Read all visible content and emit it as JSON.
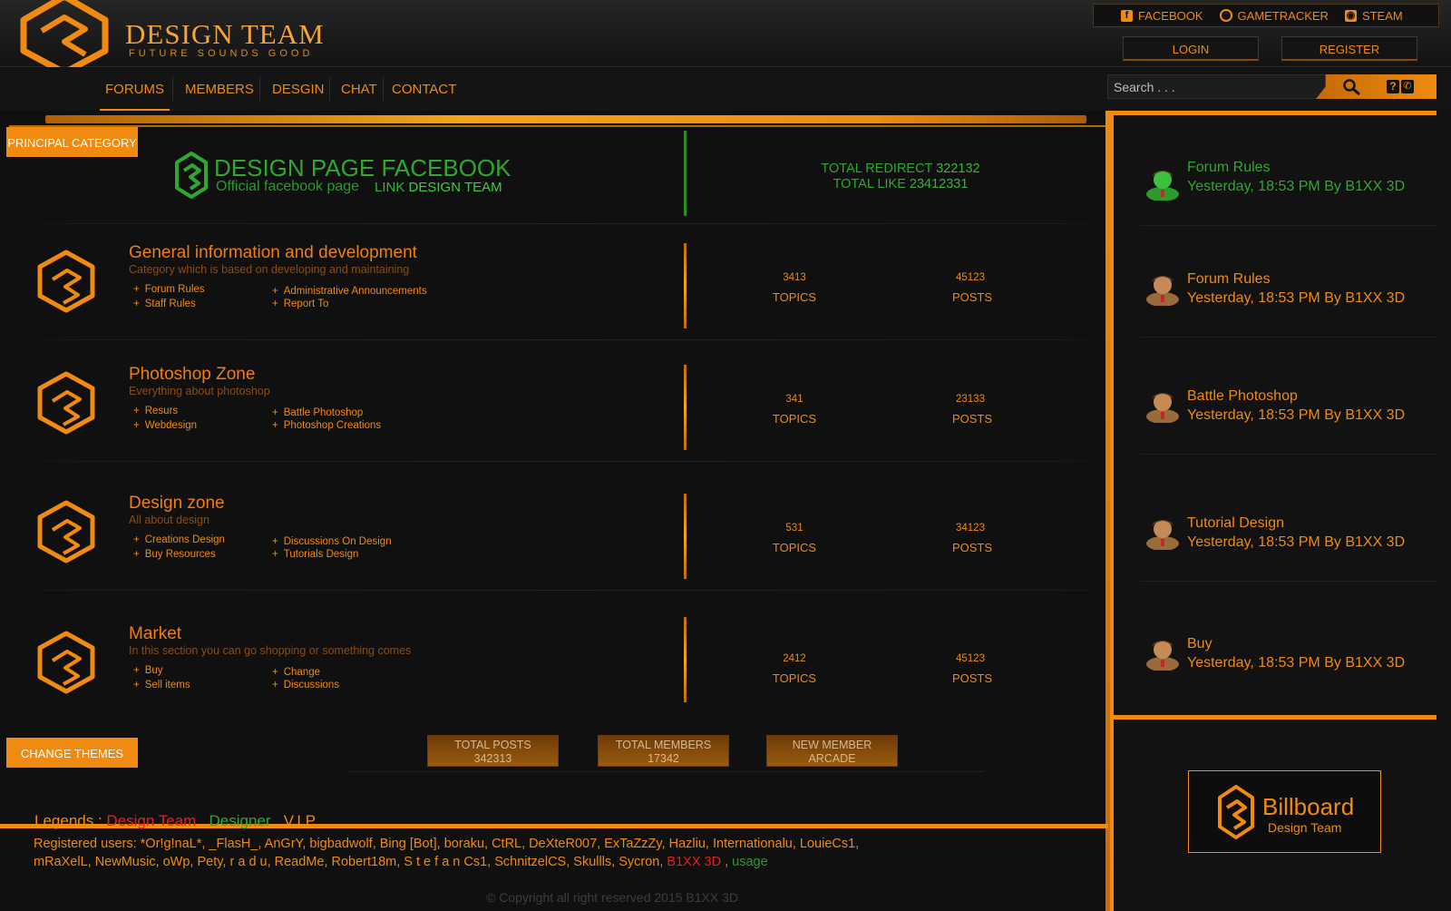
{
  "brand": {
    "title": "DESIGN TEAM",
    "tagline": "FUTURE SOUNDS GOOD"
  },
  "social": [
    {
      "label": "FACEBOOK",
      "icon": "facebook-icon"
    },
    {
      "label": "GAMETRACKER",
      "icon": "gametracker-icon"
    },
    {
      "label": "STEAM",
      "icon": "steam-icon"
    }
  ],
  "auth": {
    "login": "LOGIN",
    "register": "REGISTER"
  },
  "nav": [
    "FORUMS",
    "MEMBERS",
    "DESGIN",
    "CHAT",
    "CONTACT"
  ],
  "search": {
    "placeholder": "Search . . ."
  },
  "principal_label": "PRINCIPAL CATEGORY",
  "facebook_block": {
    "title": "DESIGN PAGE FACEBOOK",
    "subtitle": "Official facebook page",
    "link_prefix": "LINK",
    "link_text": "DESIGN TEAM",
    "redirect_label": "TOTAL REDIRECT",
    "redirect_value": "322132",
    "like_label": "TOTAL LIKE",
    "like_value": "23412331"
  },
  "categories": [
    {
      "title": "General information and development",
      "description": "Category which is based on developing and maintaining",
      "subs": [
        "Forum Rules",
        "Staff Rules",
        "Administrative Announcements",
        "Report To"
      ],
      "topics": "3413",
      "posts": "45123"
    },
    {
      "title": "Photoshop Zone",
      "description": "Everything about photoshop",
      "subs": [
        "Resurs",
        "Webdesign",
        "Battle Photoshop",
        "Photoshop Creations"
      ],
      "topics": "341",
      "posts": "23133"
    },
    {
      "title": "Design zone",
      "description": "All about design",
      "subs": [
        "Creations Design",
        "Buy Resources",
        "Discussions On Design",
        "Tutorials Design"
      ],
      "topics": "531",
      "posts": "34123"
    },
    {
      "title": "Market",
      "description": "In this section you can go shopping or something comes",
      "subs": [
        "Buy",
        "Sell items",
        "Change",
        "Discussions"
      ],
      "topics": "2412",
      "posts": "45123"
    }
  ],
  "labels": {
    "topics": "TOPICS",
    "posts": "POSTS",
    "plus": "+"
  },
  "change_themes": "CHANGE THEMES",
  "stats": [
    {
      "label": "TOTAL POSTS",
      "value": "342313"
    },
    {
      "label": "TOTAL MEMBERS",
      "value": "17342"
    },
    {
      "label": "NEW MEMBER",
      "value": "ARCADE"
    }
  ],
  "legends": {
    "label": "Legends :",
    "design_team": "Design Team",
    "designer": "Designer",
    "vip": "V.I.P",
    "sep": ","
  },
  "registered": {
    "text": "Registered users: *Or!g!naL*, _FlasH_, AnGrY, bigbadwolf, Bing [Bot], boraku, CtRL, DeXteR007, ExTaZzZy, Hazliu, Internationalu, LouieCs1, mRaXelL, NewMusic, oWp, Pety, r a d u, ReadMe, Robert18m, S t e f a n Cs1, SchnitzelCS, Skullls, Sycron,",
    "red_user": "B1XX 3D",
    "sep": ",",
    "green_user": "usage"
  },
  "copyright": "©  Copyright all right reserved 2015 B1XX 3D",
  "recent": [
    {
      "title": "Forum Rules",
      "meta": "Yesterday, 18:53 PM By B1XX 3D",
      "color": "#2ea82e"
    },
    {
      "title": "Forum Rules",
      "meta": "Yesterday, 18:53 PM By B1XX 3D",
      "color": "#f08a10"
    },
    {
      "title": "Battle Photoshop",
      "meta": "Yesterday, 18:53 PM By B1XX 3D",
      "color": "#f08a10"
    },
    {
      "title": "Tutorial Design",
      "meta": "Yesterday, 18:53 PM By B1XX 3D",
      "color": "#f08a10"
    },
    {
      "title": "Buy",
      "meta": "Yesterday, 18:53 PM By B1XX 3D",
      "color": "#f08a10"
    }
  ],
  "billboard": {
    "title": "Billboard",
    "subtitle": "Design Team"
  },
  "colors": {
    "accent": "#f08a10",
    "green": "#2ea82e",
    "red": "#e4201c",
    "background": "#0f0f0f"
  }
}
